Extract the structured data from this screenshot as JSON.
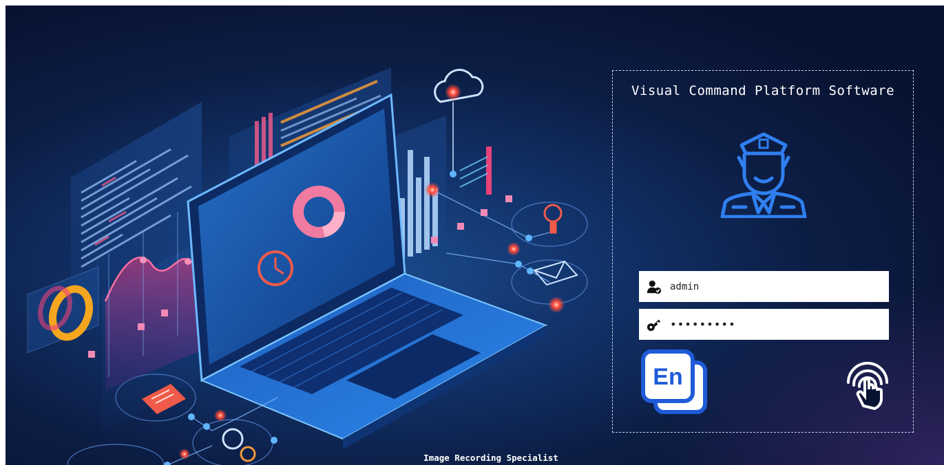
{
  "app": {
    "title": "Visual Command Platform Software",
    "footer": "Image Recording Specialist"
  },
  "login": {
    "username_value": "admin",
    "password_value": "•••••••••",
    "language_button_label": "En"
  },
  "icons": {
    "avatar": "police-officer-icon",
    "username": "user-check-icon",
    "password": "key-icon",
    "language": "language-en-icon",
    "submit": "fingerprint-touch-icon"
  },
  "colors": {
    "background": "#0c1d44",
    "accent_blue": "#2f7ff0",
    "panel_border": "#c9d3e6",
    "field_background": "#ffffff"
  }
}
